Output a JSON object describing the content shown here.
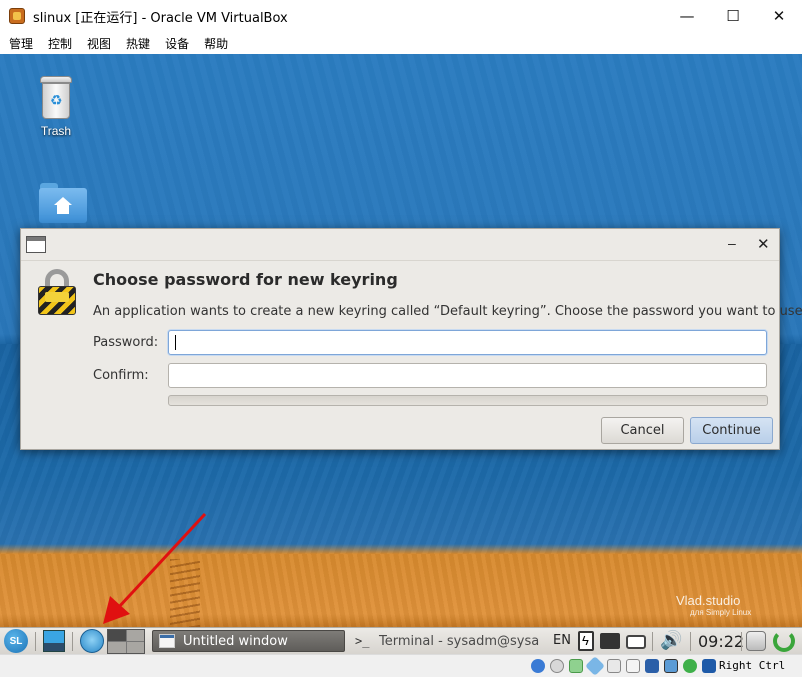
{
  "host_window": {
    "title": "slinux [正在运行] - Oracle VM VirtualBox",
    "menu": [
      "管理",
      "控制",
      "视图",
      "热键",
      "设备",
      "帮助"
    ],
    "controls": {
      "minimize": "—",
      "maximize": "☐",
      "close": "✕"
    }
  },
  "desktop": {
    "icons": [
      {
        "label": "Trash",
        "icon": "trash-icon"
      },
      {
        "label": "",
        "icon": "home-folder-icon"
      }
    ],
    "watermark": {
      "title": "Vlad.studio",
      "subtitle": "для Simply Linux"
    }
  },
  "dialog": {
    "heading": "Choose password for new keyring",
    "message": "An application wants to create a new keyring called “Default keyring”. Choose the password you want to use for it.",
    "password_label": "Password:",
    "password_value": "",
    "confirm_label": "Confirm:",
    "confirm_value": "",
    "cancel_label": "Cancel",
    "continue_label": "Continue",
    "controls": {
      "minimize": "–",
      "close": "✕"
    }
  },
  "taskbar": {
    "start_label": "SL",
    "windows": [
      {
        "label": "Untitled window",
        "active": true
      },
      {
        "label": "Terminal - sysadm@sysa...",
        "active": false
      }
    ],
    "language": "EN",
    "clock": "09:22"
  },
  "vbox_status": {
    "host_key_label": "Right Ctrl"
  },
  "colors": {
    "sky": "#2b7cc0",
    "sand": "#e0923a",
    "dialog_bg": "#eceae6",
    "arrow": "#e01010"
  }
}
